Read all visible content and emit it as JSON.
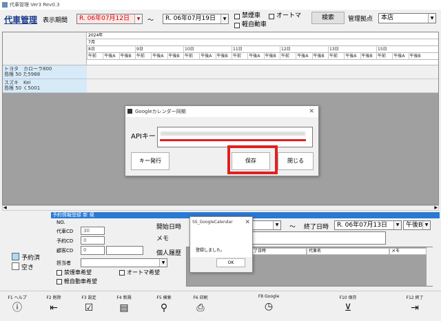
{
  "window": {
    "title": "代車管理 Ver3 Rev0.3"
  },
  "header": {
    "app_name": "代車管理",
    "period_label": "表示期間",
    "date_from": "R. 06年07月12日",
    "tilde": "～",
    "date_to": "R. 06年07月19日",
    "checkboxes": [
      "禁煙車",
      "オートマ",
      "軽自動車"
    ],
    "search_label": "検索",
    "base_label": "管理拠点",
    "base_value": "本店"
  },
  "grid": {
    "year": "2024年",
    "month": "7月",
    "days": [
      "8日",
      "9日",
      "10日",
      "11日",
      "12日",
      "13日",
      "15日"
    ],
    "slots": [
      "午前",
      "午後A",
      "午後B"
    ],
    "vehicles": [
      {
        "line1": "トヨタ　カローラ800",
        "line2": "島根 50 た5988"
      },
      {
        "line1": "スズキ　Kei",
        "line2": "島根 50 く5001"
      }
    ]
  },
  "api_dialog": {
    "title": "Googleカレンダー同期",
    "api_label": "APIキー",
    "issue_key_label": "キー発行",
    "save_label": "保存",
    "close_label": "閉じる"
  },
  "reservation": {
    "section_title": "予約情報登録 新 規",
    "no_label": "NO.",
    "vehicle_code_label": "代車CD",
    "vehicle_code_value": "30",
    "reservation_code_label": "予約CD",
    "reservation_code_value": "0",
    "customer_code_label": "顧客CD",
    "customer_code_value": "0",
    "staff_label": "担当者",
    "pref_checkboxes": [
      "禁煙車希望",
      "オートマ希望",
      "軽自動車希望"
    ],
    "start_label": "開始日時",
    "start_slot": "午前",
    "end_label": "終了日時",
    "end_date": "R. 06年07月13日",
    "end_slot": "午後B",
    "memo_label": "メモ",
    "history_label": "個人履歴",
    "history_headers": [
      "了日時",
      "代車名",
      "メモ"
    ]
  },
  "legend": {
    "reserved": "予約済",
    "vacant": "空き",
    "reserved_color": "#aadcf5"
  },
  "message_box": {
    "title": "SS_GoogleCalendar",
    "message": "登録しました。",
    "ok_label": "OK"
  },
  "function_keys": [
    {
      "key": "F1 ヘルプ",
      "icon": "help-icon"
    },
    {
      "key": "F2 削除",
      "icon": "delete-icon"
    },
    {
      "key": "F3 設定",
      "icon": "settings-icon"
    },
    {
      "key": "F4 新規",
      "icon": "new-icon"
    },
    {
      "key": "F5 検索",
      "icon": "search-icon"
    },
    {
      "key": "F6 印刷",
      "icon": "print-icon"
    },
    {
      "key": "F8 Google",
      "icon": "clock-icon"
    },
    {
      "key": "F10 保存",
      "icon": "save-icon"
    },
    {
      "key": "F12 終了",
      "icon": "exit-icon"
    }
  ],
  "colors": {
    "accent_red": "#e02020",
    "title_blue": "#1a3a8a",
    "section_blue": "#2a79d4"
  }
}
